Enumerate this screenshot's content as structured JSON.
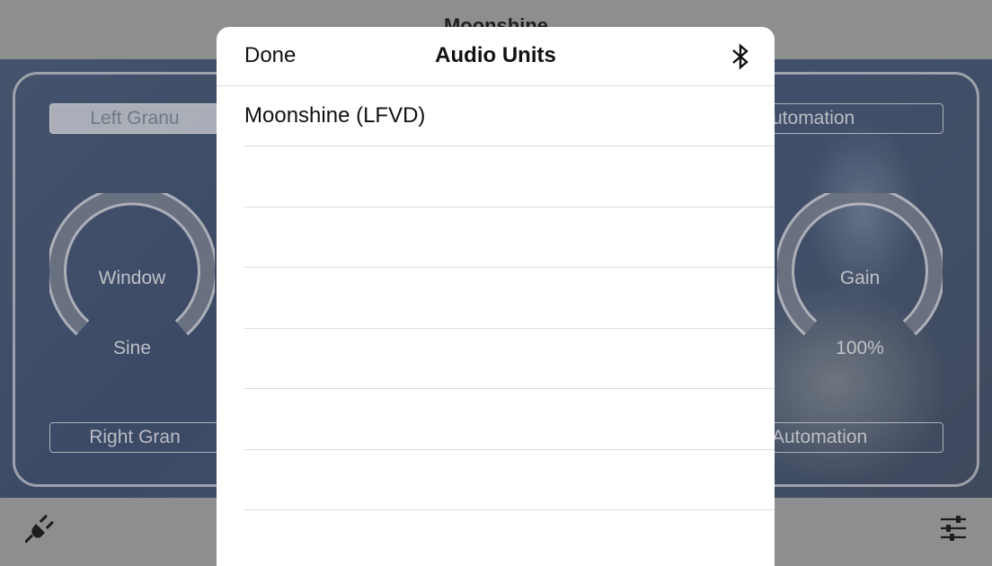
{
  "app": {
    "title": "Moonshine",
    "left_panel": {
      "top_button": "Left Granu",
      "knob_label": "Window",
      "knob_value": "Sine",
      "bottom_button": "Right Gran"
    },
    "right_panel": {
      "top_button": "utomation",
      "knob_label": "Gain",
      "knob_value": "100%",
      "bottom_button": "Automation"
    },
    "footer": {
      "left_icon": "plug-icon",
      "right_icon": "sliders-icon"
    }
  },
  "sheet": {
    "done_label": "Done",
    "title": "Audio Units",
    "bluetooth_icon": "bluetooth-icon",
    "items": [
      {
        "label": "Moonshine (LFVD)"
      },
      {
        "label": ""
      },
      {
        "label": ""
      },
      {
        "label": ""
      },
      {
        "label": ""
      },
      {
        "label": ""
      },
      {
        "label": ""
      },
      {
        "label": ""
      }
    ]
  },
  "colors": {
    "overlay_gray": "#8d8e90",
    "sheet_bg": "#ffffff",
    "separator": "#dcdcdf",
    "panel_stroke": "#bebec3"
  }
}
